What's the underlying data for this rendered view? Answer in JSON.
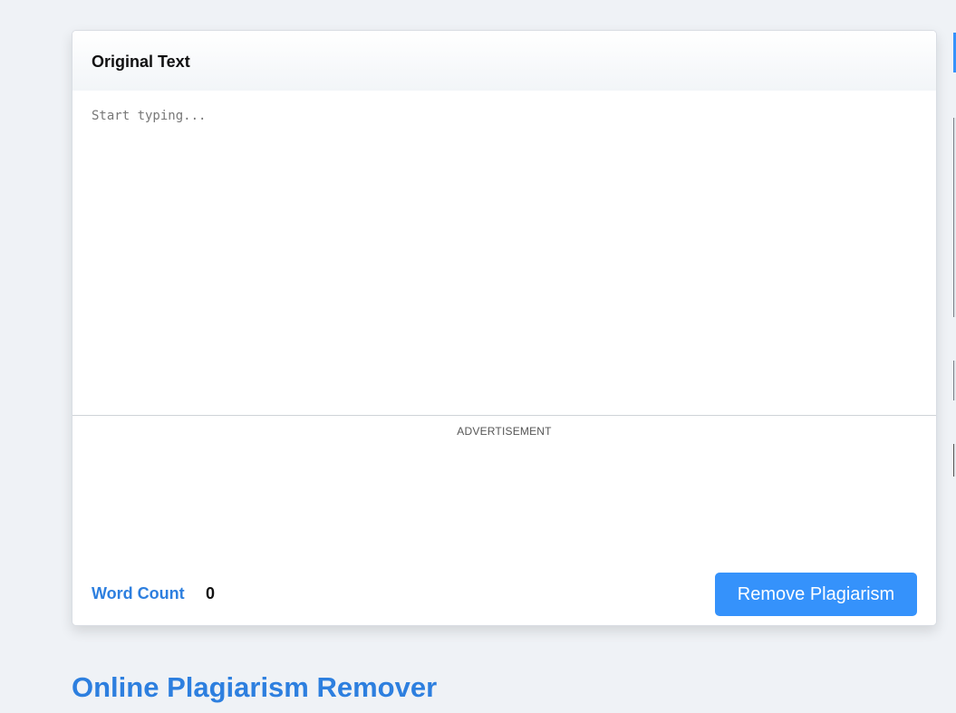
{
  "editor_card": {
    "title": "Original Text",
    "placeholder": "Start typing...",
    "advertisement_label": "ADVERTISEMENT"
  },
  "footer": {
    "word_count_label": "Word Count",
    "word_count_value": "0",
    "remove_button_label": "Remove Plagiarism"
  },
  "section": {
    "heading": "Online Plagiarism Remover"
  },
  "colors": {
    "accent": "#2d7fdf",
    "button": "#3592fb",
    "background": "#eff2f6"
  }
}
